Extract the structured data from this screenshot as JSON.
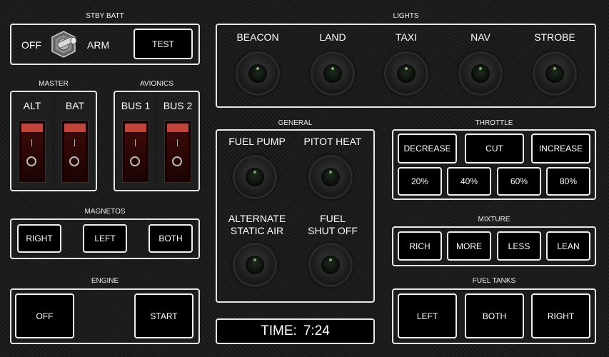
{
  "stby_batt": {
    "title": "STBY BATT",
    "off_label": "OFF",
    "arm_label": "ARM",
    "test_label": "TEST"
  },
  "master": {
    "title": "MASTER",
    "alt_label": "ALT",
    "bat_label": "BAT"
  },
  "avionics": {
    "title": "AVIONICS",
    "bus1_label": "BUS 1",
    "bus2_label": "BUS 2"
  },
  "magnetos": {
    "title": "MAGNETOS",
    "right_label": "RIGHT",
    "left_label": "LEFT",
    "both_label": "BOTH"
  },
  "engine": {
    "title": "ENGINE",
    "off_label": "OFF",
    "start_label": "START"
  },
  "lights": {
    "title": "LIGHTS",
    "items": [
      "BEACON",
      "LAND",
      "TAXI",
      "NAV",
      "STROBE"
    ]
  },
  "general": {
    "title": "GENERAL",
    "fuel_pump": "FUEL PUMP",
    "pitot_heat": "PITOT HEAT",
    "alt_static_1": "ALTERNATE",
    "alt_static_2": "STATIC AIR",
    "fuel_shutoff_1": "FUEL",
    "fuel_shutoff_2": "SHUT OFF"
  },
  "time": {
    "label": "TIME:",
    "value": "7:24"
  },
  "throttle": {
    "title": "THROTTLE",
    "decrease": "DECREASE",
    "cut": "CUT",
    "increase": "INCREASE",
    "p20": "20%",
    "p40": "40%",
    "p60": "60%",
    "p80": "80%"
  },
  "mixture": {
    "title": "MIXTURE",
    "rich": "RICH",
    "more": "MORE",
    "less": "LESS",
    "lean": "LEAN"
  },
  "fuel_tanks": {
    "title": "FUEL TANKS",
    "left": "LEFT",
    "both": "BOTH",
    "right": "RIGHT"
  }
}
